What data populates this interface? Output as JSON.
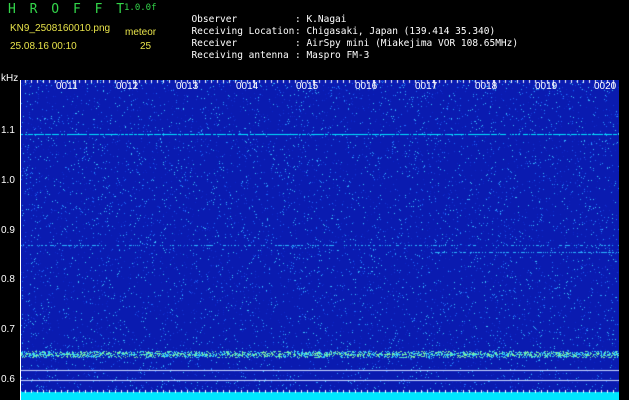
{
  "header": {
    "brand": "H R O F F T",
    "version": "1.0.0f",
    "filename": "KN9_2508160010.png",
    "meteor_label": "meteor",
    "datetime": "25.08.16 00:10",
    "meteor_count": "25"
  },
  "info": [
    {
      "key": "Observer",
      "value": "K.Nagai"
    },
    {
      "key": "Receiving Location",
      "value": "Chigasaki, Japan (139.414 35.340)"
    },
    {
      "key": "Receiver",
      "value": "AirSpy mini (Miakejima VOR 108.65MHz)"
    },
    {
      "key": "Receiving antenna",
      "value": "Maspro FM-3"
    }
  ],
  "spectrogram": {
    "y_unit": "kHz",
    "y_ticks": [
      "1.1",
      "1.0",
      "0.9",
      "0.8",
      "0.7",
      "0.6"
    ],
    "time_ticks": [
      "0011",
      "0012",
      "0013",
      "0014",
      "0015",
      "0016",
      "0017",
      "0018",
      "0019",
      "0020"
    ],
    "colors": {
      "background": "#0a1bb0",
      "noise": "#1e7cff",
      "signal": "#00e6ff",
      "baseline": "#00e6ff"
    }
  }
}
